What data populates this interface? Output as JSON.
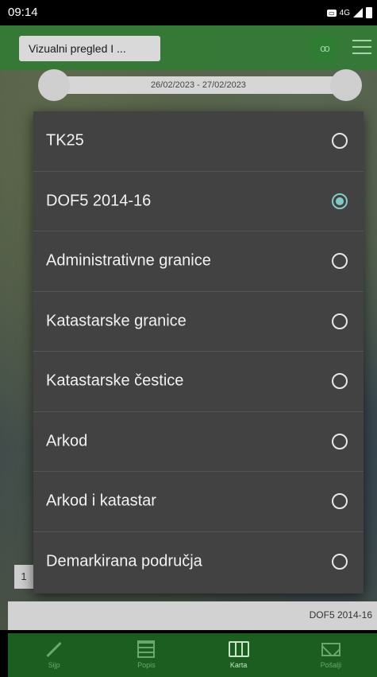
{
  "status_bar": {
    "time": "09:14",
    "network": "4G"
  },
  "app_bar": {
    "title": "Vizualni pregled I ...",
    "glasses_icon": "glasses-icon",
    "menu_icon": "menu-icon"
  },
  "date_range": "26/02/2023 - 27/02/2023",
  "layers_dialog": {
    "options": [
      {
        "label": "TK25",
        "checked": false
      },
      {
        "label": "DOF5 2014-16",
        "checked": true
      },
      {
        "label": "Administrativne granice",
        "checked": false
      },
      {
        "label": "Katastarske granice",
        "checked": false
      },
      {
        "label": "Katastarske čestice",
        "checked": false
      },
      {
        "label": "Arkod",
        "checked": false
      },
      {
        "label": "Arkod i katastar",
        "checked": false
      },
      {
        "label": "Demarkirana područja",
        "checked": false
      }
    ]
  },
  "scale_chip": "1",
  "current_layer": "DOF5 2014-16",
  "bottom_nav": {
    "items": [
      {
        "label": "Sijp",
        "icon": "wand-icon"
      },
      {
        "label": "Popis",
        "icon": "list-icon"
      },
      {
        "label": "Karta",
        "icon": "map-icon"
      },
      {
        "label": "Pošalji",
        "icon": "mail-icon"
      }
    ]
  },
  "colors": {
    "app_bar": "#2e7d32",
    "accent": "#80cbc4",
    "dialog": "#424242",
    "nav": "#1b5e20"
  }
}
